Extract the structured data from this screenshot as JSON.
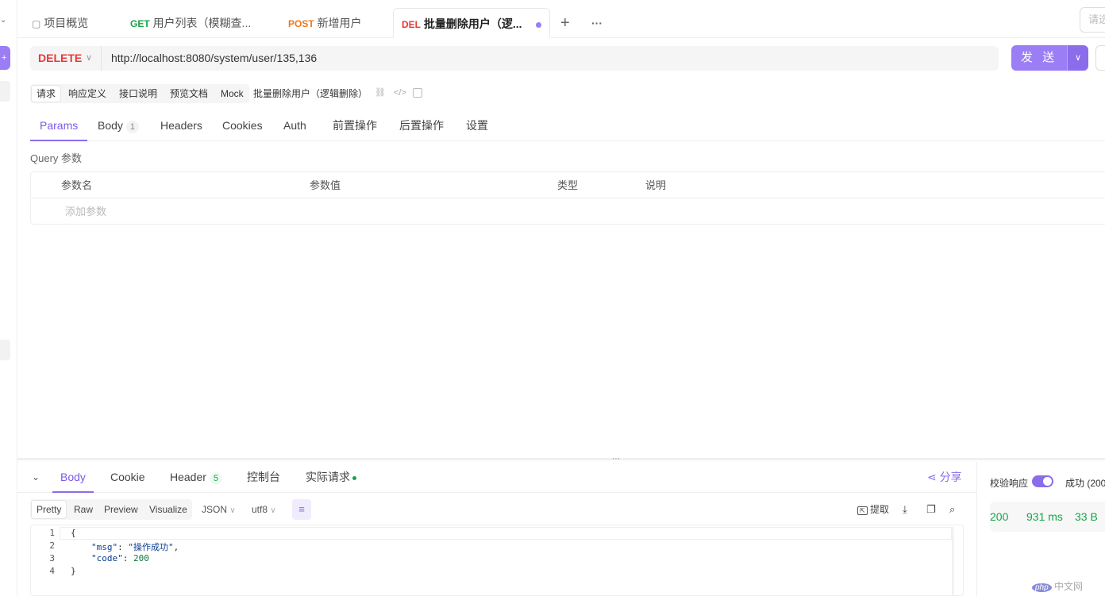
{
  "tabs": [
    {
      "method": "",
      "label": "项目概览"
    },
    {
      "method": "GET",
      "label": "用户列表（模糊查..."
    },
    {
      "method": "POST",
      "label": "新增用户"
    },
    {
      "method": "DEL",
      "label": "批量删除用户（逻..."
    }
  ],
  "tabbar": {
    "add": "+",
    "more": "···",
    "search_placeholder": "请选"
  },
  "request": {
    "method": "DELETE",
    "url": "http://localhost:8080/system/user/135,136",
    "send_label": "发 送"
  },
  "subtabs": [
    "请求",
    "响应定义",
    "接口说明",
    "预览文档",
    "Mock"
  ],
  "api_name": "批量删除用户（逻辑删除）",
  "param_tabs": [
    {
      "label": "Params",
      "badge": ""
    },
    {
      "label": "Body",
      "badge": "1"
    },
    {
      "label": "Headers",
      "badge": ""
    },
    {
      "label": "Cookies",
      "badge": ""
    },
    {
      "label": "Auth",
      "badge": ""
    },
    {
      "label": "前置操作",
      "badge": ""
    },
    {
      "label": "后置操作",
      "badge": ""
    },
    {
      "label": "设置",
      "badge": ""
    }
  ],
  "query": {
    "title": "Query 参数",
    "columns": [
      "参数名",
      "参数值",
      "类型",
      "说明"
    ],
    "add_placeholder": "添加参数"
  },
  "response": {
    "tabs": [
      {
        "label": "Body",
        "badge": ""
      },
      {
        "label": "Cookie",
        "badge": ""
      },
      {
        "label": "Header",
        "badge": "5"
      },
      {
        "label": "控制台",
        "badge": ""
      },
      {
        "label": "实际请求",
        "badge": ""
      }
    ],
    "share": "分享",
    "formats": [
      "Pretty",
      "Raw",
      "Preview",
      "Visualize"
    ],
    "type_select": "JSON",
    "encoding_select": "utf8",
    "extract": "提取",
    "lines": [
      {
        "n": "1",
        "text": "{"
      },
      {
        "n": "2",
        "key": "\"msg\"",
        "val": "\"操作成功\"",
        "trail": ","
      },
      {
        "n": "3",
        "key": "\"code\"",
        "val": "200",
        "trail": ""
      },
      {
        "n": "4",
        "text": "}"
      }
    ]
  },
  "side": {
    "verify_label": "校验响应",
    "success_label": "成功 (200",
    "status": "200",
    "time": "931 ms",
    "size": "33 B"
  },
  "watermark": {
    "logo": "php",
    "text": "中文网"
  },
  "colors": {
    "accent": "#8b6ceb",
    "delete": "#e53935",
    "get": "#17a34a",
    "post": "#f0771e"
  }
}
